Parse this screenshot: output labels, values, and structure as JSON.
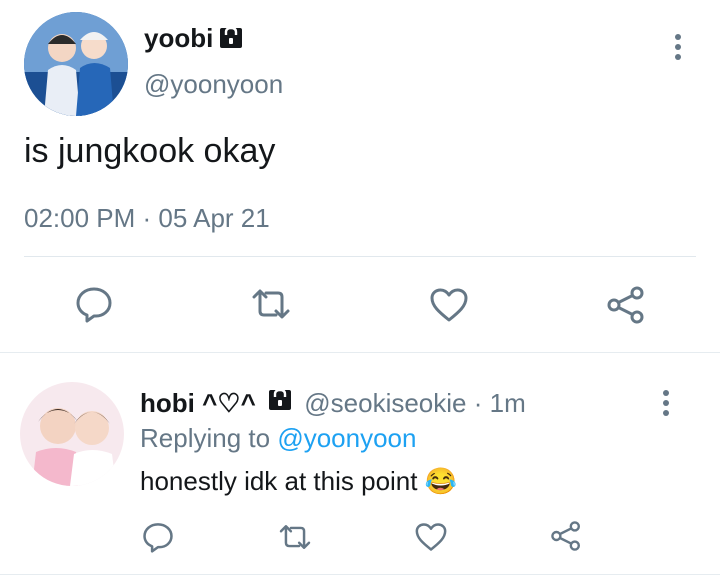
{
  "main_tweet": {
    "display_name": "yoobi",
    "handle": "@yoonyoon",
    "text": "is jungkook okay",
    "timestamp": "02:00 PM · 05 Apr 21",
    "icons": [
      "reply-icon",
      "retweet-icon",
      "like-icon",
      "share-icon"
    ],
    "avatar_colors": [
      "#1f5fa8",
      "#e9eef6",
      "#2b2b2b"
    ]
  },
  "reply": {
    "display_name": "hobi ^♡^",
    "handle": "@seokiseokie",
    "time": "· 1m",
    "replying_prefix": "Replying to",
    "replying_to": "@yoonyoon",
    "text": "honestly idk at this point",
    "emoji": "😂",
    "icons": [
      "reply-icon",
      "retweet-icon",
      "like-icon",
      "share-icon"
    ],
    "avatar_colors": [
      "#f4b8cc",
      "#3a2a22",
      "#ffffff"
    ]
  },
  "colors": {
    "text": "#14171a",
    "secondary": "#657786",
    "link": "#1da1f2",
    "divider": "#e1e8ed"
  }
}
